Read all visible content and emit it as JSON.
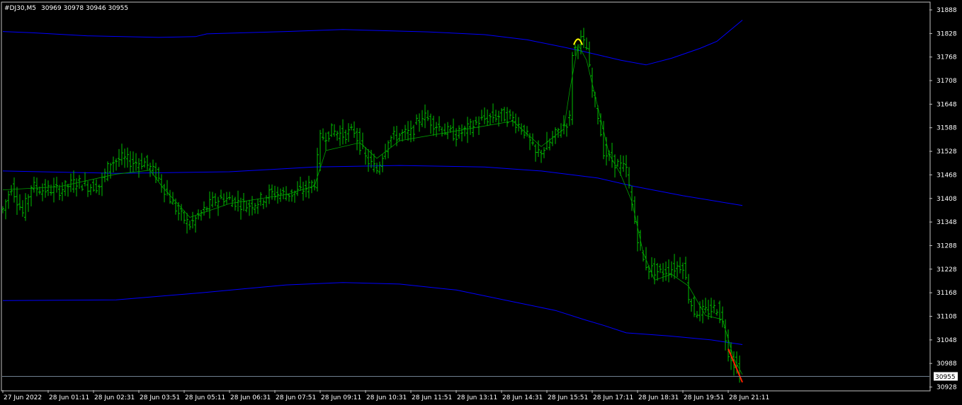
{
  "header": {
    "symbol": "#DJ30,M5",
    "ohlc": "30969 30978 30946 30955"
  },
  "colors": {
    "background": "#000000",
    "frame": "#c0c0c0",
    "bars": "#00c000",
    "band": "#0000ff",
    "ma": "#00a000",
    "last_price_line": "#708090",
    "marker_yellow": "#ffff00",
    "marker_red": "#ff2000"
  },
  "chart_data": {
    "type": "line",
    "style": "ohlc-bars-with-bands",
    "y_ticks": [
      31888,
      31828,
      31768,
      31708,
      31648,
      31588,
      31528,
      31468,
      31408,
      31348,
      31288,
      31228,
      31168,
      31108,
      31048,
      30988,
      30928
    ],
    "ylim": [
      30920,
      31906
    ],
    "x_ticks": [
      "27 Jun 2022",
      "28 Jun 01:11",
      "28 Jun 02:31",
      "28 Jun 03:51",
      "28 Jun 05:11",
      "28 Jun 06:31",
      "28 Jun 07:51",
      "28 Jun 09:11",
      "28 Jun 10:31",
      "28 Jun 11:51",
      "28 Jun 13:11",
      "28 Jun 14:31",
      "28 Jun 15:51",
      "28 Jun 17:11",
      "28 Jun 18:31",
      "28 Jun 19:51",
      "28 Jun 21:11"
    ],
    "last_price": 30955,
    "last_price_label": "30955",
    "bar_count": 261,
    "price_path": [
      [
        0,
        31380
      ],
      [
        3,
        31440
      ],
      [
        7,
        31370
      ],
      [
        10,
        31440
      ],
      [
        14,
        31430
      ],
      [
        20,
        31430
      ],
      [
        26,
        31450
      ],
      [
        30,
        31440
      ],
      [
        34,
        31440
      ],
      [
        38,
        31500
      ],
      [
        42,
        31510
      ],
      [
        46,
        31500
      ],
      [
        50,
        31500
      ],
      [
        54,
        31470
      ],
      [
        58,
        31420
      ],
      [
        62,
        31370
      ],
      [
        66,
        31340
      ],
      [
        70,
        31370
      ],
      [
        74,
        31400
      ],
      [
        78,
        31410
      ],
      [
        82,
        31400
      ],
      [
        86,
        31390
      ],
      [
        90,
        31400
      ],
      [
        94,
        31420
      ],
      [
        98,
        31420
      ],
      [
        102,
        31420
      ],
      [
        106,
        31430
      ],
      [
        110,
        31450
      ],
      [
        112,
        31560
      ],
      [
        116,
        31580
      ],
      [
        120,
        31570
      ],
      [
        124,
        31580
      ],
      [
        128,
        31510
      ],
      [
        132,
        31480
      ],
      [
        136,
        31560
      ],
      [
        140,
        31570
      ],
      [
        144,
        31575
      ],
      [
        148,
        31620
      ],
      [
        152,
        31600
      ],
      [
        156,
        31580
      ],
      [
        160,
        31570
      ],
      [
        164,
        31585
      ],
      [
        168,
        31605
      ],
      [
        172,
        31615
      ],
      [
        176,
        31620
      ],
      [
        180,
        31610
      ],
      [
        184,
        31580
      ],
      [
        188,
        31520
      ],
      [
        192,
        31540
      ],
      [
        196,
        31580
      ],
      [
        200,
        31610
      ],
      [
        201,
        31780
      ],
      [
        204,
        31810
      ],
      [
        206,
        31790
      ],
      [
        208,
        31680
      ],
      [
        210,
        31620
      ],
      [
        212,
        31530
      ],
      [
        214,
        31510
      ],
      [
        218,
        31490
      ],
      [
        220,
        31480
      ],
      [
        222,
        31390
      ],
      [
        224,
        31310
      ],
      [
        226,
        31250
      ],
      [
        228,
        31230
      ],
      [
        232,
        31220
      ],
      [
        236,
        31230
      ],
      [
        240,
        31240
      ],
      [
        242,
        31160
      ],
      [
        244,
        31120
      ],
      [
        248,
        31120
      ],
      [
        252,
        31130
      ],
      [
        254,
        31090
      ],
      [
        256,
        31020
      ],
      [
        258,
        30990
      ],
      [
        261,
        30955
      ]
    ],
    "ma_path": [
      [
        0,
        31430
      ],
      [
        20,
        31438
      ],
      [
        40,
        31470
      ],
      [
        52,
        31480
      ],
      [
        56,
        31440
      ],
      [
        66,
        31360
      ],
      [
        80,
        31395
      ],
      [
        100,
        31418
      ],
      [
        110,
        31440
      ],
      [
        114,
        31530
      ],
      [
        126,
        31550
      ],
      [
        132,
        31510
      ],
      [
        140,
        31555
      ],
      [
        160,
        31580
      ],
      [
        180,
        31605
      ],
      [
        190,
        31540
      ],
      [
        198,
        31585
      ],
      [
        200,
        31680
      ],
      [
        203,
        31800
      ],
      [
        206,
        31760
      ],
      [
        210,
        31640
      ],
      [
        214,
        31520
      ],
      [
        218,
        31470
      ],
      [
        222,
        31400
      ],
      [
        226,
        31270
      ],
      [
        230,
        31200
      ],
      [
        236,
        31215
      ],
      [
        242,
        31185
      ],
      [
        248,
        31110
      ],
      [
        254,
        31100
      ],
      [
        258,
        31000
      ],
      [
        261,
        30960
      ]
    ],
    "series": [
      {
        "values": [
          [
            0,
            31833
          ],
          [
            10,
            31830
          ],
          [
            30,
            31822
          ],
          [
            55,
            31818
          ],
          [
            68,
            31820
          ],
          [
            72,
            31827
          ],
          [
            100,
            31833
          ],
          [
            120,
            31838
          ],
          [
            150,
            31832
          ],
          [
            170,
            31825
          ],
          [
            185,
            31812
          ],
          [
            198,
            31793
          ],
          [
            205,
            31782
          ],
          [
            218,
            31760
          ],
          [
            227,
            31748
          ],
          [
            236,
            31765
          ],
          [
            246,
            31790
          ],
          [
            252,
            31808
          ],
          [
            256,
            31832
          ],
          [
            259,
            31850
          ],
          [
            261,
            31862
          ]
        ]
      },
      {
        "values": [
          [
            0,
            31478
          ],
          [
            40,
            31472
          ],
          [
            80,
            31476
          ],
          [
            110,
            31488
          ],
          [
            140,
            31492
          ],
          [
            170,
            31488
          ],
          [
            190,
            31478
          ],
          [
            210,
            31460
          ],
          [
            222,
            31440
          ],
          [
            240,
            31415
          ],
          [
            261,
            31390
          ]
        ]
      },
      {
        "values": [
          [
            0,
            31148
          ],
          [
            40,
            31150
          ],
          [
            70,
            31168
          ],
          [
            100,
            31188
          ],
          [
            120,
            31194
          ],
          [
            140,
            31190
          ],
          [
            160,
            31175
          ],
          [
            180,
            31145
          ],
          [
            195,
            31123
          ],
          [
            205,
            31100
          ],
          [
            212,
            31085
          ],
          [
            220,
            31066
          ],
          [
            235,
            31058
          ],
          [
            250,
            31048
          ],
          [
            261,
            31036
          ]
        ]
      }
    ]
  }
}
